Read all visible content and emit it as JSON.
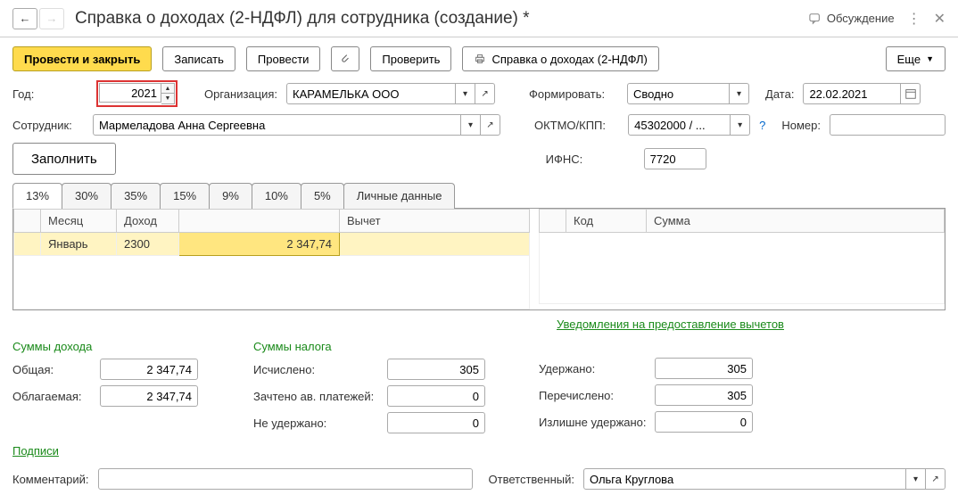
{
  "header": {
    "title": "Справка о доходах (2-НДФЛ) для сотрудника (создание) *",
    "discuss": "Обсуждение"
  },
  "toolbar": {
    "post_close": "Провести и закрыть",
    "save": "Записать",
    "post": "Провести",
    "check": "Проверить",
    "report": "Справка о доходах (2-НДФЛ)",
    "more": "Еще"
  },
  "form": {
    "year_lbl": "Год:",
    "year": "2021",
    "org_lbl": "Организация:",
    "org": "КАРАМЕЛЬКА ООО",
    "form_lbl": "Формировать:",
    "form_val": "Сводно",
    "date_lbl": "Дата:",
    "date": "22.02.2021",
    "emp_lbl": "Сотрудник:",
    "emp": "Мармеладова Анна Сергеевна",
    "oktmo_lbl": "ОКТМО/КПП:",
    "oktmo": "45302000 / ...",
    "num_lbl": "Номер:",
    "num": "",
    "fill": "Заполнить",
    "ifns_lbl": "ИФНС:",
    "ifns": "7720"
  },
  "tabs": [
    "13%",
    "30%",
    "35%",
    "15%",
    "9%",
    "10%",
    "5%",
    "Личные данные"
  ],
  "grid_left": {
    "cols": [
      "",
      "Месяц",
      "Доход",
      "",
      "Вычет"
    ],
    "row": {
      "month": "Январь",
      "code": "2300",
      "amount": "2 347,74",
      "deduct": ""
    }
  },
  "grid_right": {
    "cols": [
      "",
      "Код",
      "Сумма"
    ]
  },
  "notif_link": "Уведомления на предоставление вычетов",
  "summary": {
    "income_head": "Суммы дохода",
    "tax_head": "Суммы налога",
    "total_lbl": "Общая:",
    "total": "2 347,74",
    "taxable_lbl": "Облагаемая:",
    "taxable": "2 347,74",
    "calc_lbl": "Исчислено:",
    "calc": "305",
    "advance_lbl": "Зачтено ав. платежей:",
    "advance": "0",
    "notret_lbl": "Не удержано:",
    "notret": "0",
    "held_lbl": "Удержано:",
    "held": "305",
    "trans_lbl": "Перечислено:",
    "trans": "305",
    "over_lbl": "Излишне удержано:",
    "over": "0"
  },
  "sign_link": "Подписи",
  "footer": {
    "comment_lbl": "Комментарий:",
    "resp_lbl": "Ответственный:",
    "resp": "Ольга Круглова"
  }
}
